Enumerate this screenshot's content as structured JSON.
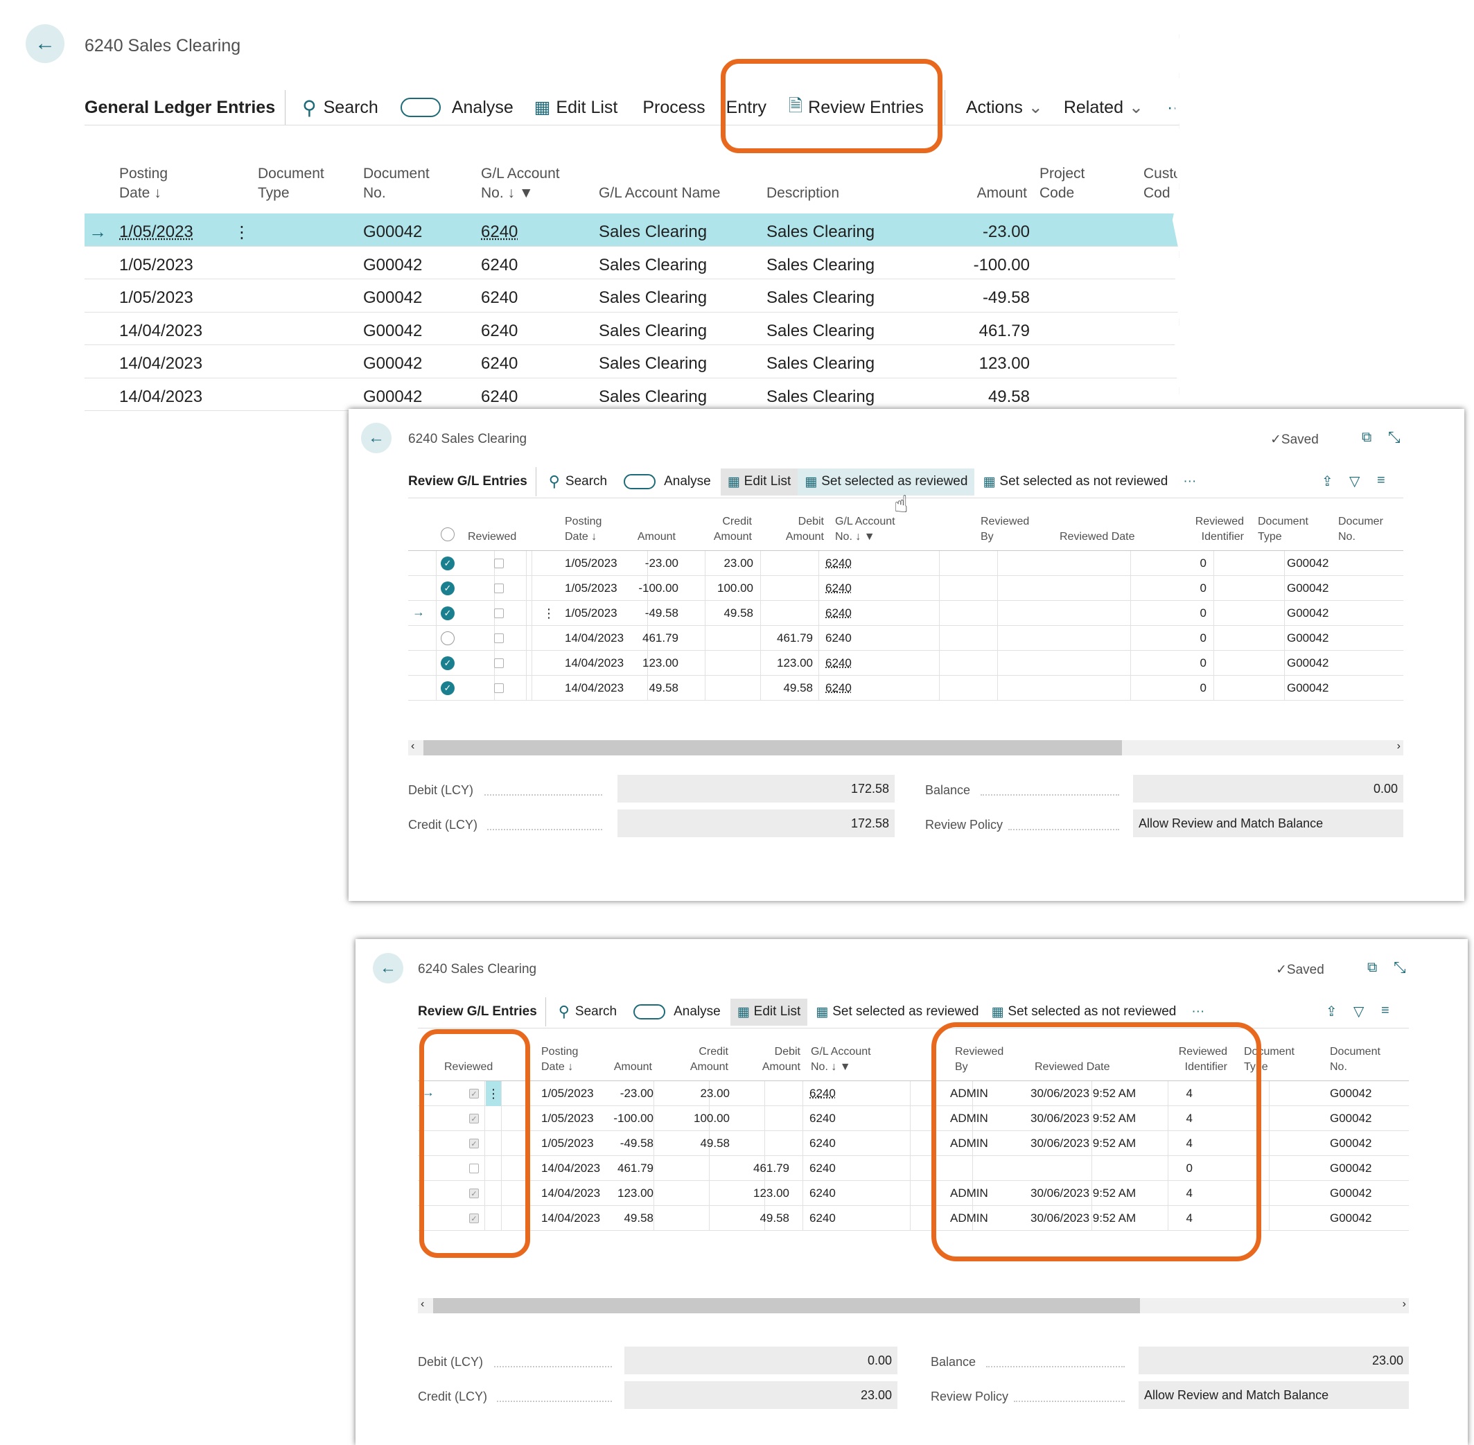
{
  "screen1": {
    "title": "6240 Sales Clearing",
    "toolbar": {
      "page_label": "General Ledger Entries",
      "search": "Search",
      "analyse": "Analyse",
      "edit_list": "Edit List",
      "process": "Process",
      "entry": "Entry",
      "review_entries": "Review Entries",
      "actions": "Actions",
      "related": "Related",
      "more": "···"
    },
    "columns": [
      "Posting Date",
      "Document Type",
      "Document No.",
      "G/L Account No.",
      "G/L Account Name",
      "Description",
      "Amount",
      "Project Code",
      "Customer Code"
    ],
    "col_labels": {
      "posting_date_l1": "Posting",
      "posting_date_l2": "Date ↓",
      "doc_type_l1": "Document",
      "doc_type_l2": "Type",
      "doc_no_l1": "Document",
      "doc_no_l2": "No.",
      "gl_acc_l1": "G/L Account",
      "gl_acc_l2": "No. ↓",
      "gl_name": "G/L Account Name",
      "description": "Description",
      "amount": "Amount",
      "project_l1": "Project",
      "project_l2": "Code",
      "cust_l1": "Custo",
      "cust_l2": "Cod"
    },
    "rows": [
      {
        "date": "1/05/2023",
        "doc_no": "G00042",
        "acc": "6240",
        "name": "Sales Clearing",
        "desc": "Sales Clearing",
        "amount": "-23.00"
      },
      {
        "date": "1/05/2023",
        "doc_no": "G00042",
        "acc": "6240",
        "name": "Sales Clearing",
        "desc": "Sales Clearing",
        "amount": "-100.00"
      },
      {
        "date": "1/05/2023",
        "doc_no": "G00042",
        "acc": "6240",
        "name": "Sales Clearing",
        "desc": "Sales Clearing",
        "amount": "-49.58"
      },
      {
        "date": "14/04/2023",
        "doc_no": "G00042",
        "acc": "6240",
        "name": "Sales Clearing",
        "desc": "Sales Clearing",
        "amount": "461.79"
      },
      {
        "date": "14/04/2023",
        "doc_no": "G00042",
        "acc": "6240",
        "name": "Sales Clearing",
        "desc": "Sales Clearing",
        "amount": "123.00"
      },
      {
        "date": "14/04/2023",
        "doc_no": "G00042",
        "acc": "6240",
        "name": "Sales Clearing",
        "desc": "Sales Clearing",
        "amount": "49.58"
      }
    ]
  },
  "screen2": {
    "title": "6240 Sales Clearing",
    "saved": "Saved",
    "toolbar": {
      "page_label": "Review G/L Entries",
      "search": "Search",
      "analyse": "Analyse",
      "edit_list": "Edit List",
      "set_reviewed": "Set selected as reviewed",
      "set_not_reviewed": "Set selected as not reviewed",
      "more": "···"
    },
    "col_labels": {
      "reviewed": "Reviewed",
      "posting_l1": "Posting",
      "posting_l2": "Date ↓",
      "amount": "Amount",
      "credit_l1": "Credit",
      "credit_l2": "Amount",
      "debit_l1": "Debit",
      "debit_l2": "Amount",
      "gl_l1": "G/L Account",
      "gl_l2": "No. ↓",
      "by_l1": "Reviewed",
      "by_l2": "By",
      "rdate": "Reviewed Date",
      "ident_l1": "Reviewed",
      "ident_l2": "Identifier",
      "dtype_l1": "Document",
      "dtype_l2": "Type",
      "dno_l1": "Documer",
      "dno_l2": "No."
    },
    "rows": [
      {
        "selected": true,
        "reviewed": false,
        "date": "1/05/2023",
        "amount": "-23.00",
        "credit": "23.00",
        "debit": "",
        "acc": "6240",
        "by": "",
        "rdate": "",
        "ident": "0",
        "dtype": "",
        "dno": "G00042"
      },
      {
        "selected": true,
        "reviewed": false,
        "date": "1/05/2023",
        "amount": "-100.00",
        "credit": "100.00",
        "debit": "",
        "acc": "6240",
        "by": "",
        "rdate": "",
        "ident": "0",
        "dtype": "",
        "dno": "G00042"
      },
      {
        "selected": true,
        "reviewed": false,
        "date": "1/05/2023",
        "amount": "-49.58",
        "credit": "49.58",
        "debit": "",
        "acc": "6240",
        "by": "",
        "rdate": "",
        "ident": "0",
        "dtype": "",
        "dno": "G00042"
      },
      {
        "selected": false,
        "reviewed": false,
        "date": "14/04/2023",
        "amount": "461.79",
        "credit": "",
        "debit": "461.79",
        "acc": "6240",
        "by": "",
        "rdate": "",
        "ident": "0",
        "dtype": "",
        "dno": "G00042"
      },
      {
        "selected": true,
        "reviewed": false,
        "date": "14/04/2023",
        "amount": "123.00",
        "credit": "",
        "debit": "123.00",
        "acc": "6240",
        "by": "",
        "rdate": "",
        "ident": "0",
        "dtype": "",
        "dno": "G00042"
      },
      {
        "selected": true,
        "reviewed": false,
        "date": "14/04/2023",
        "amount": "49.58",
        "credit": "",
        "debit": "49.58",
        "acc": "6240",
        "by": "",
        "rdate": "",
        "ident": "0",
        "dtype": "",
        "dno": "G00042"
      }
    ],
    "footer": {
      "debit_label": "Debit (LCY)",
      "debit_value": "172.58",
      "credit_label": "Credit (LCY)",
      "credit_value": "172.58",
      "balance_label": "Balance",
      "balance_value": "0.00",
      "policy_label": "Review Policy",
      "policy_value": "Allow Review and Match Balance"
    }
  },
  "screen3": {
    "title": "6240 Sales Clearing",
    "saved": "Saved",
    "toolbar": {
      "page_label": "Review G/L Entries",
      "search": "Search",
      "analyse": "Analyse",
      "edit_list": "Edit List",
      "set_reviewed": "Set selected as reviewed",
      "set_not_reviewed": "Set selected as not reviewed",
      "more": "···"
    },
    "col_labels": {
      "reviewed": "Reviewed",
      "posting_l1": "Posting",
      "posting_l2": "Date ↓",
      "amount": "Amount",
      "credit_l1": "Credit",
      "credit_l2": "Amount",
      "debit_l1": "Debit",
      "debit_l2": "Amount",
      "gl_l1": "G/L Account",
      "gl_l2": "No. ↓",
      "by_l1": "Reviewed",
      "by_l2": "By",
      "rdate": "Reviewed Date",
      "ident_l1": "Reviewed",
      "ident_l2": "Identifier",
      "dtype_l1": "Document",
      "dtype_l2": "Type",
      "dno_l1": "Document",
      "dno_l2": "No."
    },
    "rows": [
      {
        "reviewed": true,
        "date": "1/05/2023",
        "amount": "-23.00",
        "credit": "23.00",
        "debit": "",
        "acc": "6240",
        "by": "ADMIN",
        "rdate": "30/06/2023 9:52 AM",
        "ident": "4",
        "dno": "G00042"
      },
      {
        "reviewed": true,
        "date": "1/05/2023",
        "amount": "-100.00",
        "credit": "100.00",
        "debit": "",
        "acc": "6240",
        "by": "ADMIN",
        "rdate": "30/06/2023 9:52 AM",
        "ident": "4",
        "dno": "G00042"
      },
      {
        "reviewed": true,
        "date": "1/05/2023",
        "amount": "-49.58",
        "credit": "49.58",
        "debit": "",
        "acc": "6240",
        "by": "ADMIN",
        "rdate": "30/06/2023 9:52 AM",
        "ident": "4",
        "dno": "G00042"
      },
      {
        "reviewed": false,
        "date": "14/04/2023",
        "amount": "461.79",
        "credit": "",
        "debit": "461.79",
        "acc": "6240",
        "by": "",
        "rdate": "",
        "ident": "0",
        "dno": "G00042"
      },
      {
        "reviewed": true,
        "date": "14/04/2023",
        "amount": "123.00",
        "credit": "",
        "debit": "123.00",
        "acc": "6240",
        "by": "ADMIN",
        "rdate": "30/06/2023 9:52 AM",
        "ident": "4",
        "dno": "G00042"
      },
      {
        "reviewed": true,
        "date": "14/04/2023",
        "amount": "49.58",
        "credit": "",
        "debit": "49.58",
        "acc": "6240",
        "by": "ADMIN",
        "rdate": "30/06/2023 9:52 AM",
        "ident": "4",
        "dno": "G00042"
      }
    ],
    "footer": {
      "debit_label": "Debit (LCY)",
      "debit_value": "0.00",
      "credit_label": "Credit (LCY)",
      "credit_value": "23.00",
      "balance_label": "Balance",
      "balance_value": "23.00",
      "policy_label": "Review Policy",
      "policy_value": "Allow Review and Match Balance"
    }
  },
  "colors": {
    "accent": "#1d6a78",
    "selected_row": "#aee4ea",
    "highlight": "#e8681e",
    "check_selected": "#1a7f8e"
  },
  "icons": {
    "back": "←",
    "arrow": "→",
    "search": "⚲",
    "check": "✓",
    "cursor": "hand-pointer-icon"
  }
}
